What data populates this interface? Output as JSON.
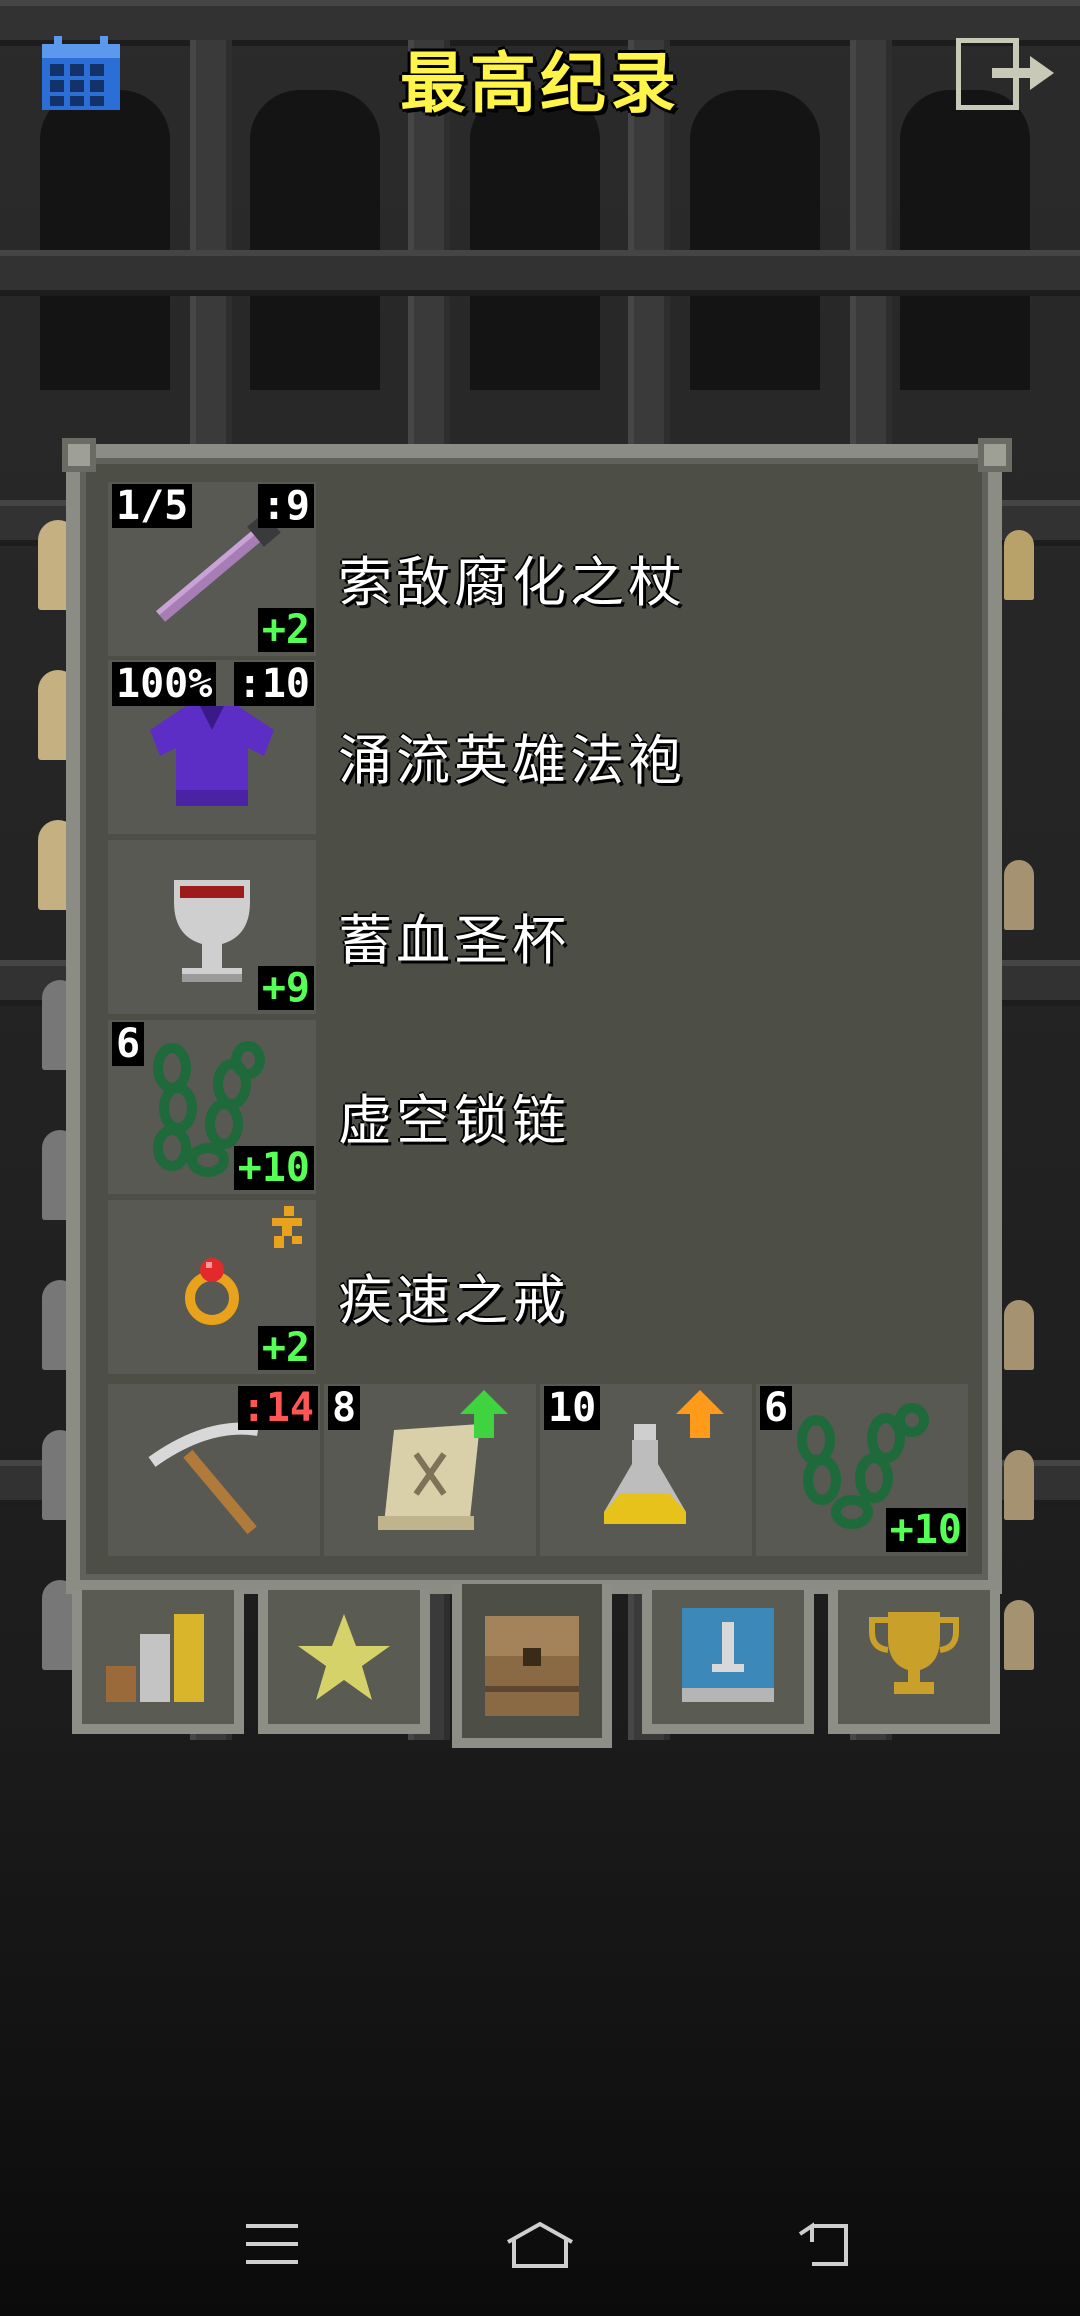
{
  "header": {
    "title": "最高纪录",
    "calendar_icon": "calendar-icon",
    "exit_icon": "exit-icon"
  },
  "equipment": [
    {
      "name": "索敌腐化之杖",
      "icon": "wand-icon",
      "top_left": "1/5",
      "top_right": ":9",
      "bottom_right": "+2"
    },
    {
      "name": "涌流英雄法袍",
      "icon": "robe-icon",
      "top_left": "100%",
      "top_right": ":10",
      "bottom_right": ""
    },
    {
      "name": "蓄血圣杯",
      "icon": "chalice-icon",
      "top_left": "",
      "top_right": "",
      "bottom_right": "+9"
    },
    {
      "name": "虚空锁链",
      "icon": "chains-icon",
      "top_left": "6",
      "top_right": "",
      "bottom_right": "+10"
    },
    {
      "name": "疾速之戒",
      "icon": "ring-icon",
      "top_left": "",
      "top_right": "speed-rune-icon",
      "bottom_right": "+2"
    }
  ],
  "quickslots": [
    {
      "icon": "pickaxe-icon",
      "top_left": "",
      "top_right": ":14",
      "bottom_right": ""
    },
    {
      "icon": "scroll-icon",
      "top_left": "8",
      "top_right": "green-arrow-icon",
      "bottom_right": ""
    },
    {
      "icon": "potion-icon",
      "top_left": "10",
      "top_right": "orange-arrow-icon",
      "bottom_right": ""
    },
    {
      "icon": "chains-icon",
      "top_left": "6",
      "top_right": "",
      "bottom_right": "+10"
    }
  ],
  "tabs": [
    {
      "icon": "stats-icon",
      "active": false
    },
    {
      "icon": "star-icon",
      "active": false
    },
    {
      "icon": "backpack-icon",
      "active": true
    },
    {
      "icon": "sword-banner-icon",
      "active": false
    },
    {
      "icon": "trophy-icon",
      "active": false
    }
  ],
  "navbar": [
    "menu-icon",
    "home-icon",
    "back-icon"
  ],
  "colors": {
    "title": "#fff44a",
    "bonus": "#55ff55",
    "durability": "#ff5555",
    "panel": "#4d4f47",
    "frame": "#8b8d84"
  }
}
